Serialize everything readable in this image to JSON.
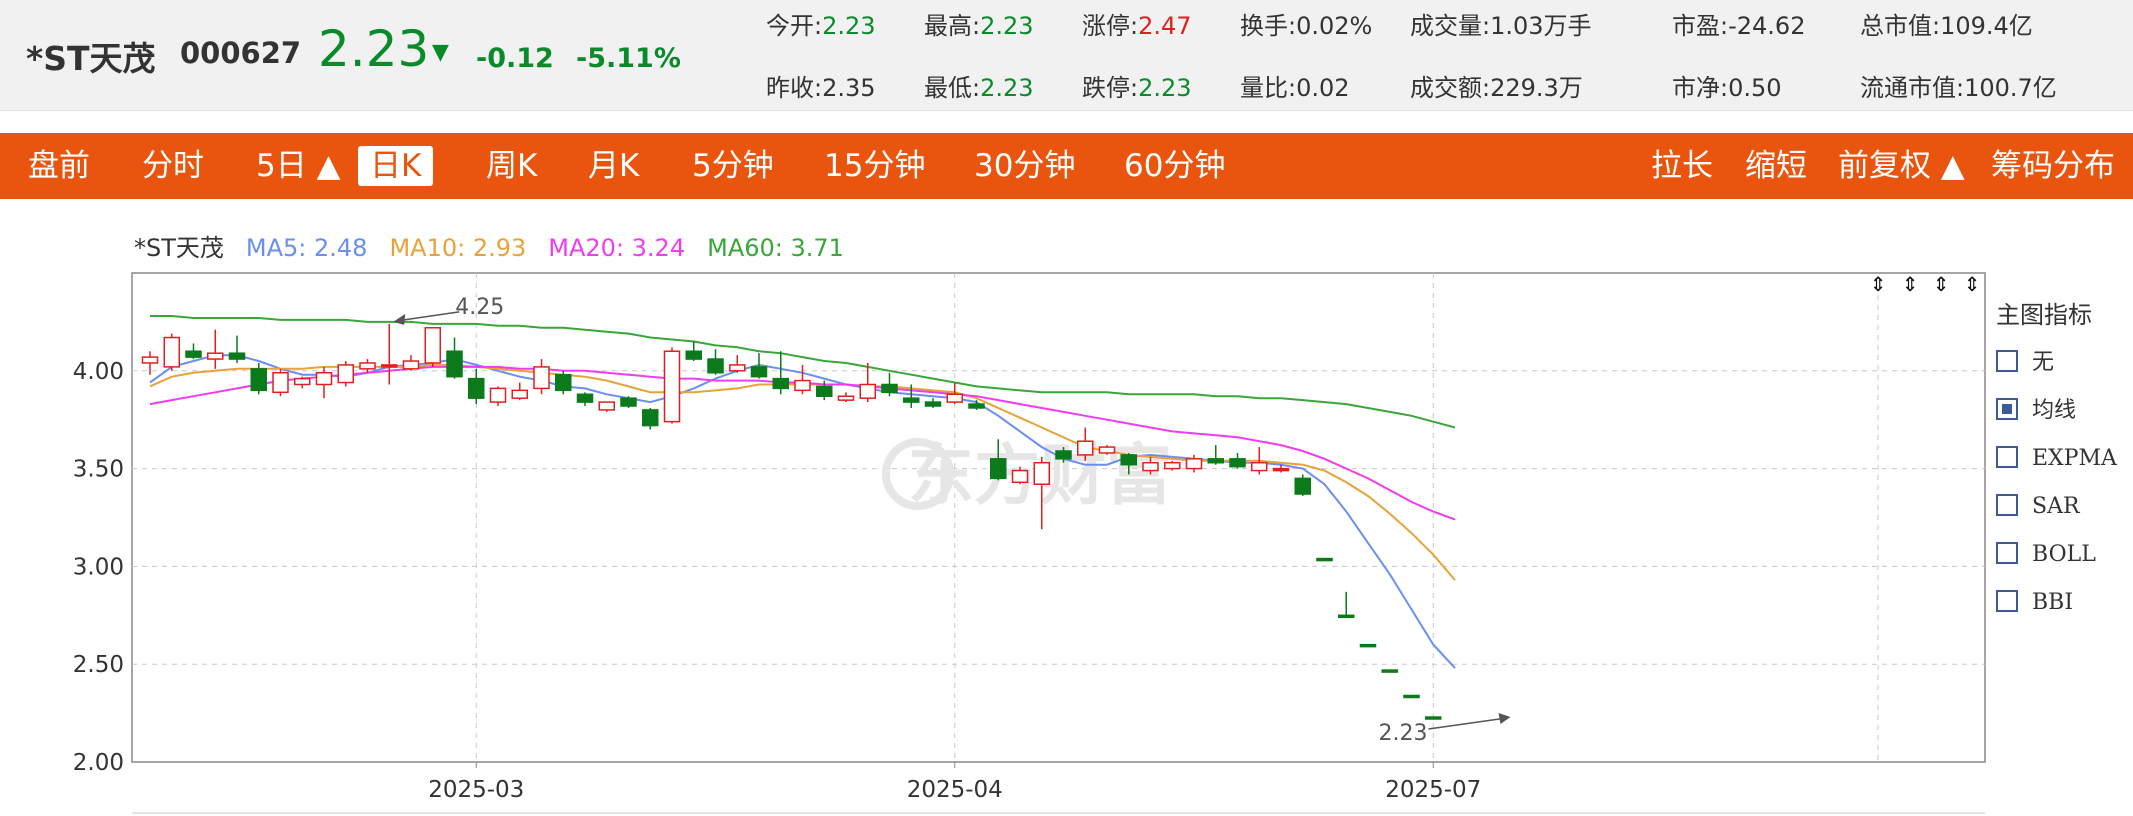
{
  "header": {
    "name": "*ST天茂",
    "code": "000627",
    "price": "2.23",
    "change": "-0.12",
    "change_pct": "-5.11%",
    "stats": [
      {
        "label": "今开:",
        "value": "2.23",
        "tone": "green"
      },
      {
        "label": "最高:",
        "value": "2.23",
        "tone": "green"
      },
      {
        "label": "涨停:",
        "value": "2.47",
        "tone": "red"
      },
      {
        "label": "换手:",
        "value": "0.02%",
        "tone": ""
      },
      {
        "label": "成交量:",
        "value": "1.03万手",
        "tone": ""
      },
      {
        "label": "市盈:",
        "value": "-24.62",
        "tone": ""
      },
      {
        "label": "总市值:",
        "value": "109.4亿",
        "tone": ""
      },
      {
        "label": "昨收:",
        "value": "2.35",
        "tone": ""
      },
      {
        "label": "最低:",
        "value": "2.23",
        "tone": "green"
      },
      {
        "label": "跌停:",
        "value": "2.23",
        "tone": "green"
      },
      {
        "label": "量比:",
        "value": "0.02",
        "tone": ""
      },
      {
        "label": "成交额:",
        "value": "229.3万",
        "tone": ""
      },
      {
        "label": "市净:",
        "value": "0.50",
        "tone": ""
      },
      {
        "label": "流通市值:",
        "value": "100.7亿",
        "tone": ""
      }
    ]
  },
  "toolbar": {
    "left": [
      "盘前",
      "分时",
      "5日 ▲",
      "日K",
      "周K",
      "月K",
      "5分钟",
      "15分钟",
      "30分钟",
      "60分钟"
    ],
    "active": "日K",
    "right": [
      "拉长",
      "缩短",
      "前复权 ▲",
      "筹码分布"
    ]
  },
  "legend": {
    "name": "*ST天茂",
    "items": [
      {
        "label": "MA5: 2.48",
        "color": "#6b8ef0"
      },
      {
        "label": "MA10: 2.93",
        "color": "#e8a23a"
      },
      {
        "label": "MA20: 3.24",
        "color": "#f03cf0"
      },
      {
        "label": "MA60: 3.71",
        "color": "#3aa63a"
      }
    ]
  },
  "watermark": "东方财富",
  "indicators": {
    "title": "主图指标",
    "items": [
      {
        "label": "无",
        "checked": false
      },
      {
        "label": "均线",
        "checked": true
      },
      {
        "label": "EXPMA",
        "checked": false
      },
      {
        "label": "SAR",
        "checked": false
      },
      {
        "label": "BOLL",
        "checked": false
      },
      {
        "label": "BBI",
        "checked": false
      }
    ]
  },
  "colors": {
    "up": "#e02020",
    "down": "#0a7a1a",
    "accent": "#e9550e"
  },
  "chart_data": {
    "type": "candlestick",
    "ylim": [
      2.0,
      4.5
    ],
    "yticks": [
      "2.00",
      "2.50",
      "3.00",
      "3.50",
      "4.00"
    ],
    "xticks": [
      {
        "label": "2025-03",
        "index": 15
      },
      {
        "label": "2025-04",
        "index": 37
      },
      {
        "label": "2025-07",
        "index": 59
      }
    ],
    "annotations": [
      {
        "text": "4.25",
        "index": 11,
        "value": 4.25
      },
      {
        "text": "2.23",
        "index": 62,
        "value": 2.23
      }
    ],
    "candles": [
      {
        "o": 4.04,
        "c": 4.07,
        "h": 4.1,
        "l": 3.98
      },
      {
        "o": 4.02,
        "c": 4.17,
        "h": 4.19,
        "l": 4.0
      },
      {
        "o": 4.1,
        "c": 4.07,
        "h": 4.14,
        "l": 4.06
      },
      {
        "o": 4.06,
        "c": 4.09,
        "h": 4.21,
        "l": 4.01
      },
      {
        "o": 4.09,
        "c": 4.06,
        "h": 4.18,
        "l": 4.04
      },
      {
        "o": 4.01,
        "c": 3.9,
        "h": 4.04,
        "l": 3.88
      },
      {
        "o": 3.89,
        "c": 3.99,
        "h": 4.01,
        "l": 3.87
      },
      {
        "o": 3.93,
        "c": 3.96,
        "h": 3.97,
        "l": 3.91
      },
      {
        "o": 3.93,
        "c": 3.99,
        "h": 4.02,
        "l": 3.86
      },
      {
        "o": 3.94,
        "c": 4.03,
        "h": 4.05,
        "l": 3.92
      },
      {
        "o": 4.01,
        "c": 4.04,
        "h": 4.06,
        "l": 3.99
      },
      {
        "o": 4.03,
        "c": 4.03,
        "h": 4.24,
        "l": 3.93
      },
      {
        "o": 4.01,
        "c": 4.05,
        "h": 4.08,
        "l": 4.0
      },
      {
        "o": 4.04,
        "c": 4.22,
        "h": 4.22,
        "l": 4.02
      },
      {
        "o": 4.1,
        "c": 3.97,
        "h": 4.17,
        "l": 3.96
      },
      {
        "o": 3.96,
        "c": 3.86,
        "h": 4.01,
        "l": 3.83
      },
      {
        "o": 3.84,
        "c": 3.91,
        "h": 3.92,
        "l": 3.82
      },
      {
        "o": 3.86,
        "c": 3.9,
        "h": 3.94,
        "l": 3.85
      },
      {
        "o": 3.91,
        "c": 4.02,
        "h": 4.06,
        "l": 3.88
      },
      {
        "o": 3.98,
        "c": 3.9,
        "h": 4.0,
        "l": 3.88
      },
      {
        "o": 3.88,
        "c": 3.84,
        "h": 3.89,
        "l": 3.82
      },
      {
        "o": 3.8,
        "c": 3.84,
        "h": 3.84,
        "l": 3.79
      },
      {
        "o": 3.86,
        "c": 3.82,
        "h": 3.87,
        "l": 3.81
      },
      {
        "o": 3.8,
        "c": 3.72,
        "h": 3.81,
        "l": 3.7
      },
      {
        "o": 3.74,
        "c": 4.1,
        "h": 4.12,
        "l": 3.73
      },
      {
        "o": 4.1,
        "c": 4.06,
        "h": 4.15,
        "l": 4.05
      },
      {
        "o": 4.06,
        "c": 3.99,
        "h": 4.11,
        "l": 3.98
      },
      {
        "o": 4.0,
        "c": 4.03,
        "h": 4.08,
        "l": 3.99
      },
      {
        "o": 4.02,
        "c": 3.97,
        "h": 4.09,
        "l": 3.96
      },
      {
        "o": 3.96,
        "c": 3.91,
        "h": 4.1,
        "l": 3.88
      },
      {
        "o": 3.9,
        "c": 3.95,
        "h": 4.03,
        "l": 3.88
      },
      {
        "o": 3.92,
        "c": 3.87,
        "h": 3.95,
        "l": 3.85
      },
      {
        "o": 3.85,
        "c": 3.87,
        "h": 3.89,
        "l": 3.84
      },
      {
        "o": 3.86,
        "c": 3.93,
        "h": 4.04,
        "l": 3.84
      },
      {
        "o": 3.93,
        "c": 3.89,
        "h": 3.99,
        "l": 3.87
      },
      {
        "o": 3.86,
        "c": 3.84,
        "h": 3.93,
        "l": 3.81
      },
      {
        "o": 3.84,
        "c": 3.82,
        "h": 3.86,
        "l": 3.81
      },
      {
        "o": 3.84,
        "c": 3.88,
        "h": 3.94,
        "l": 3.83
      },
      {
        "o": 3.83,
        "c": 3.81,
        "h": 3.85,
        "l": 3.8
      },
      {
        "o": 3.55,
        "c": 3.45,
        "h": 3.65,
        "l": 3.44
      },
      {
        "o": 3.43,
        "c": 3.49,
        "h": 3.51,
        "l": 3.42
      },
      {
        "o": 3.42,
        "c": 3.53,
        "h": 3.56,
        "l": 3.19
      },
      {
        "o": 3.59,
        "c": 3.55,
        "h": 3.61,
        "l": 3.53
      },
      {
        "o": 3.57,
        "c": 3.64,
        "h": 3.71,
        "l": 3.54
      },
      {
        "o": 3.58,
        "c": 3.61,
        "h": 3.62,
        "l": 3.57
      },
      {
        "o": 3.57,
        "c": 3.52,
        "h": 3.58,
        "l": 3.47
      },
      {
        "o": 3.49,
        "c": 3.53,
        "h": 3.56,
        "l": 3.47
      },
      {
        "o": 3.5,
        "c": 3.53,
        "h": 3.54,
        "l": 3.49
      },
      {
        "o": 3.5,
        "c": 3.55,
        "h": 3.57,
        "l": 3.48
      },
      {
        "o": 3.55,
        "c": 3.53,
        "h": 3.62,
        "l": 3.52
      },
      {
        "o": 3.55,
        "c": 3.51,
        "h": 3.58,
        "l": 3.5
      },
      {
        "o": 3.49,
        "c": 3.53,
        "h": 3.61,
        "l": 3.47
      },
      {
        "o": 3.5,
        "c": 3.5,
        "h": 3.52,
        "l": 3.48
      },
      {
        "o": 3.45,
        "c": 3.37,
        "h": 3.47,
        "l": 3.36
      },
      {
        "o": 3.04,
        "c": 3.04,
        "h": 3.04,
        "l": 3.04
      },
      {
        "o": 2.75,
        "c": 2.75,
        "h": 2.87,
        "l": 2.75
      },
      {
        "o": 2.6,
        "c": 2.6,
        "h": 2.6,
        "l": 2.6
      },
      {
        "o": 2.47,
        "c": 2.47,
        "h": 2.47,
        "l": 2.47
      },
      {
        "o": 2.34,
        "c": 2.34,
        "h": 2.34,
        "l": 2.34
      },
      {
        "o": 2.23,
        "c": 2.23,
        "h": 2.23,
        "l": 2.23
      }
    ],
    "ma": [
      {
        "name": "MA5",
        "color": "#6b8ef0",
        "values": [
          3.94,
          4.02,
          4.05,
          4.08,
          4.08,
          4.05,
          4.01,
          3.98,
          3.98,
          3.97,
          3.99,
          4.02,
          4.03,
          4.04,
          4.06,
          4.03,
          4.0,
          3.97,
          3.95,
          3.92,
          3.91,
          3.88,
          3.86,
          3.84,
          3.87,
          3.91,
          3.96,
          4.0,
          4.03,
          4.01,
          3.99,
          3.96,
          3.93,
          3.91,
          3.89,
          3.88,
          3.87,
          3.86,
          3.84,
          3.77,
          3.69,
          3.61,
          3.55,
          3.52,
          3.52,
          3.56,
          3.57,
          3.56,
          3.55,
          3.54,
          3.53,
          3.53,
          3.52,
          3.5,
          3.42,
          3.28,
          3.12,
          2.96,
          2.78,
          2.6,
          2.48
        ]
      },
      {
        "name": "MA10",
        "color": "#e8a23a",
        "values": [
          3.92,
          3.97,
          3.99,
          4.0,
          4.01,
          4.01,
          4.01,
          4.01,
          4.02,
          4.02,
          4.02,
          4.02,
          4.02,
          4.03,
          4.03,
          4.02,
          4.01,
          4.0,
          3.99,
          3.98,
          3.97,
          3.95,
          3.92,
          3.89,
          3.89,
          3.89,
          3.9,
          3.91,
          3.93,
          3.93,
          3.93,
          3.93,
          3.93,
          3.92,
          3.92,
          3.91,
          3.9,
          3.89,
          3.86,
          3.81,
          3.76,
          3.71,
          3.66,
          3.61,
          3.59,
          3.57,
          3.56,
          3.55,
          3.54,
          3.54,
          3.54,
          3.54,
          3.53,
          3.52,
          3.49,
          3.43,
          3.36,
          3.27,
          3.17,
          3.06,
          2.93
        ]
      },
      {
        "name": "MA20",
        "color": "#f03cf0",
        "values": [
          3.83,
          3.85,
          3.87,
          3.89,
          3.91,
          3.93,
          3.95,
          3.96,
          3.97,
          3.98,
          3.99,
          4.0,
          4.01,
          4.02,
          4.02,
          4.02,
          4.02,
          4.01,
          4.01,
          4.0,
          4.0,
          3.99,
          3.98,
          3.97,
          3.96,
          3.96,
          3.95,
          3.95,
          3.95,
          3.94,
          3.94,
          3.93,
          3.93,
          3.92,
          3.91,
          3.9,
          3.89,
          3.88,
          3.87,
          3.85,
          3.83,
          3.81,
          3.79,
          3.77,
          3.75,
          3.73,
          3.71,
          3.69,
          3.68,
          3.67,
          3.66,
          3.64,
          3.62,
          3.59,
          3.55,
          3.5,
          3.45,
          3.39,
          3.33,
          3.28,
          3.24
        ]
      },
      {
        "name": "MA60",
        "color": "#3aa63a",
        "values": [
          4.28,
          4.28,
          4.27,
          4.27,
          4.27,
          4.27,
          4.26,
          4.26,
          4.26,
          4.26,
          4.25,
          4.25,
          4.25,
          4.24,
          4.24,
          4.24,
          4.23,
          4.23,
          4.22,
          4.22,
          4.21,
          4.2,
          4.19,
          4.17,
          4.16,
          4.15,
          4.13,
          4.12,
          4.1,
          4.09,
          4.07,
          4.05,
          4.04,
          4.02,
          4.0,
          3.98,
          3.96,
          3.94,
          3.92,
          3.91,
          3.9,
          3.89,
          3.89,
          3.89,
          3.89,
          3.88,
          3.88,
          3.88,
          3.88,
          3.87,
          3.87,
          3.86,
          3.86,
          3.85,
          3.84,
          3.83,
          3.81,
          3.79,
          3.77,
          3.74,
          3.71
        ]
      }
    ]
  }
}
